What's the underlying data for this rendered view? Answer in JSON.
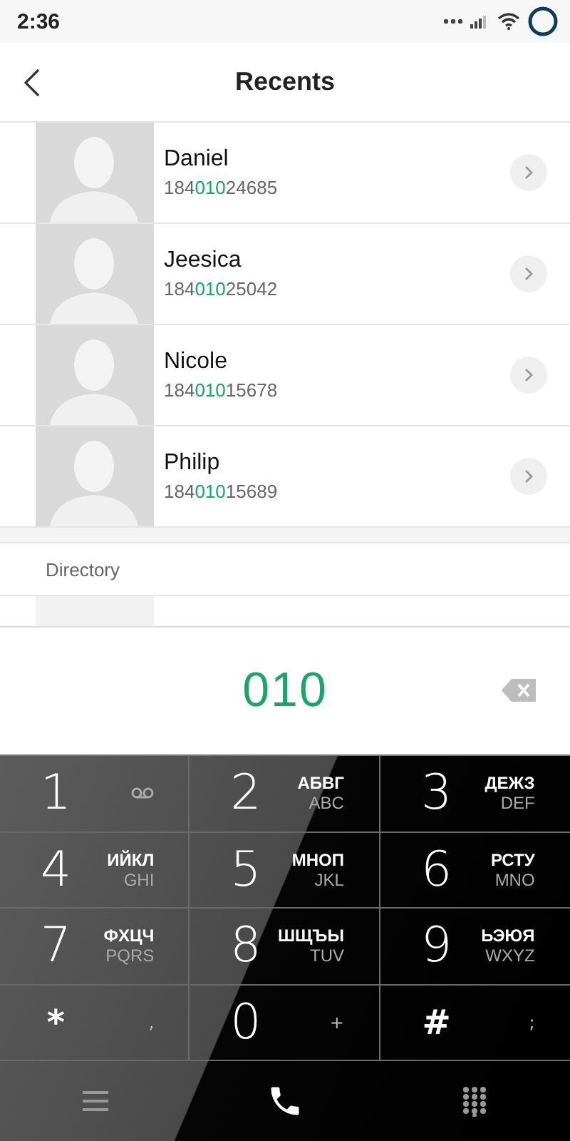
{
  "status_bar": {
    "time": "2:36"
  },
  "header": {
    "title": "Recents"
  },
  "contacts": [
    {
      "name": "Daniel",
      "number_before": "184",
      "number_match": "010",
      "number_after": "24685"
    },
    {
      "name": "Jeesica",
      "number_before": "184",
      "number_match": "010",
      "number_after": "25042"
    },
    {
      "name": "Nicole",
      "number_before": "184",
      "number_match": "010",
      "number_after": "15678"
    },
    {
      "name": "Philip",
      "number_before": "184",
      "number_match": "010",
      "number_after": "15689"
    }
  ],
  "directory": {
    "title": "Directory"
  },
  "dial_display": {
    "value": "010"
  },
  "keys": [
    {
      "kind": "voicemail",
      "digit": "1"
    },
    {
      "kind": "letters",
      "digit": "2",
      "cyrillic": "АБВГ",
      "latin": "ABC"
    },
    {
      "kind": "letters",
      "digit": "3",
      "cyrillic": "ДЕЖЗ",
      "latin": "DEF"
    },
    {
      "kind": "letters",
      "digit": "4",
      "cyrillic": "ИЙКЛ",
      "latin": "GHI"
    },
    {
      "kind": "letters",
      "digit": "5",
      "cyrillic": "МНОП",
      "latin": "JKL"
    },
    {
      "kind": "letters",
      "digit": "6",
      "cyrillic": "РСТУ",
      "latin": "MNO"
    },
    {
      "kind": "letters",
      "digit": "7",
      "cyrillic": "ФХЦЧ",
      "latin": "PQRS"
    },
    {
      "kind": "letters",
      "digit": "8",
      "cyrillic": "ШЩЪЫ",
      "latin": "TUV"
    },
    {
      "kind": "letters",
      "digit": "9",
      "cyrillic": "ЬЭЮЯ",
      "latin": "WXYZ"
    },
    {
      "kind": "symbol",
      "digit": "*",
      "extra": ","
    },
    {
      "kind": "digit",
      "digit": "0",
      "extra": "+"
    },
    {
      "kind": "symbol",
      "digit": "#",
      "extra": ";"
    }
  ]
}
